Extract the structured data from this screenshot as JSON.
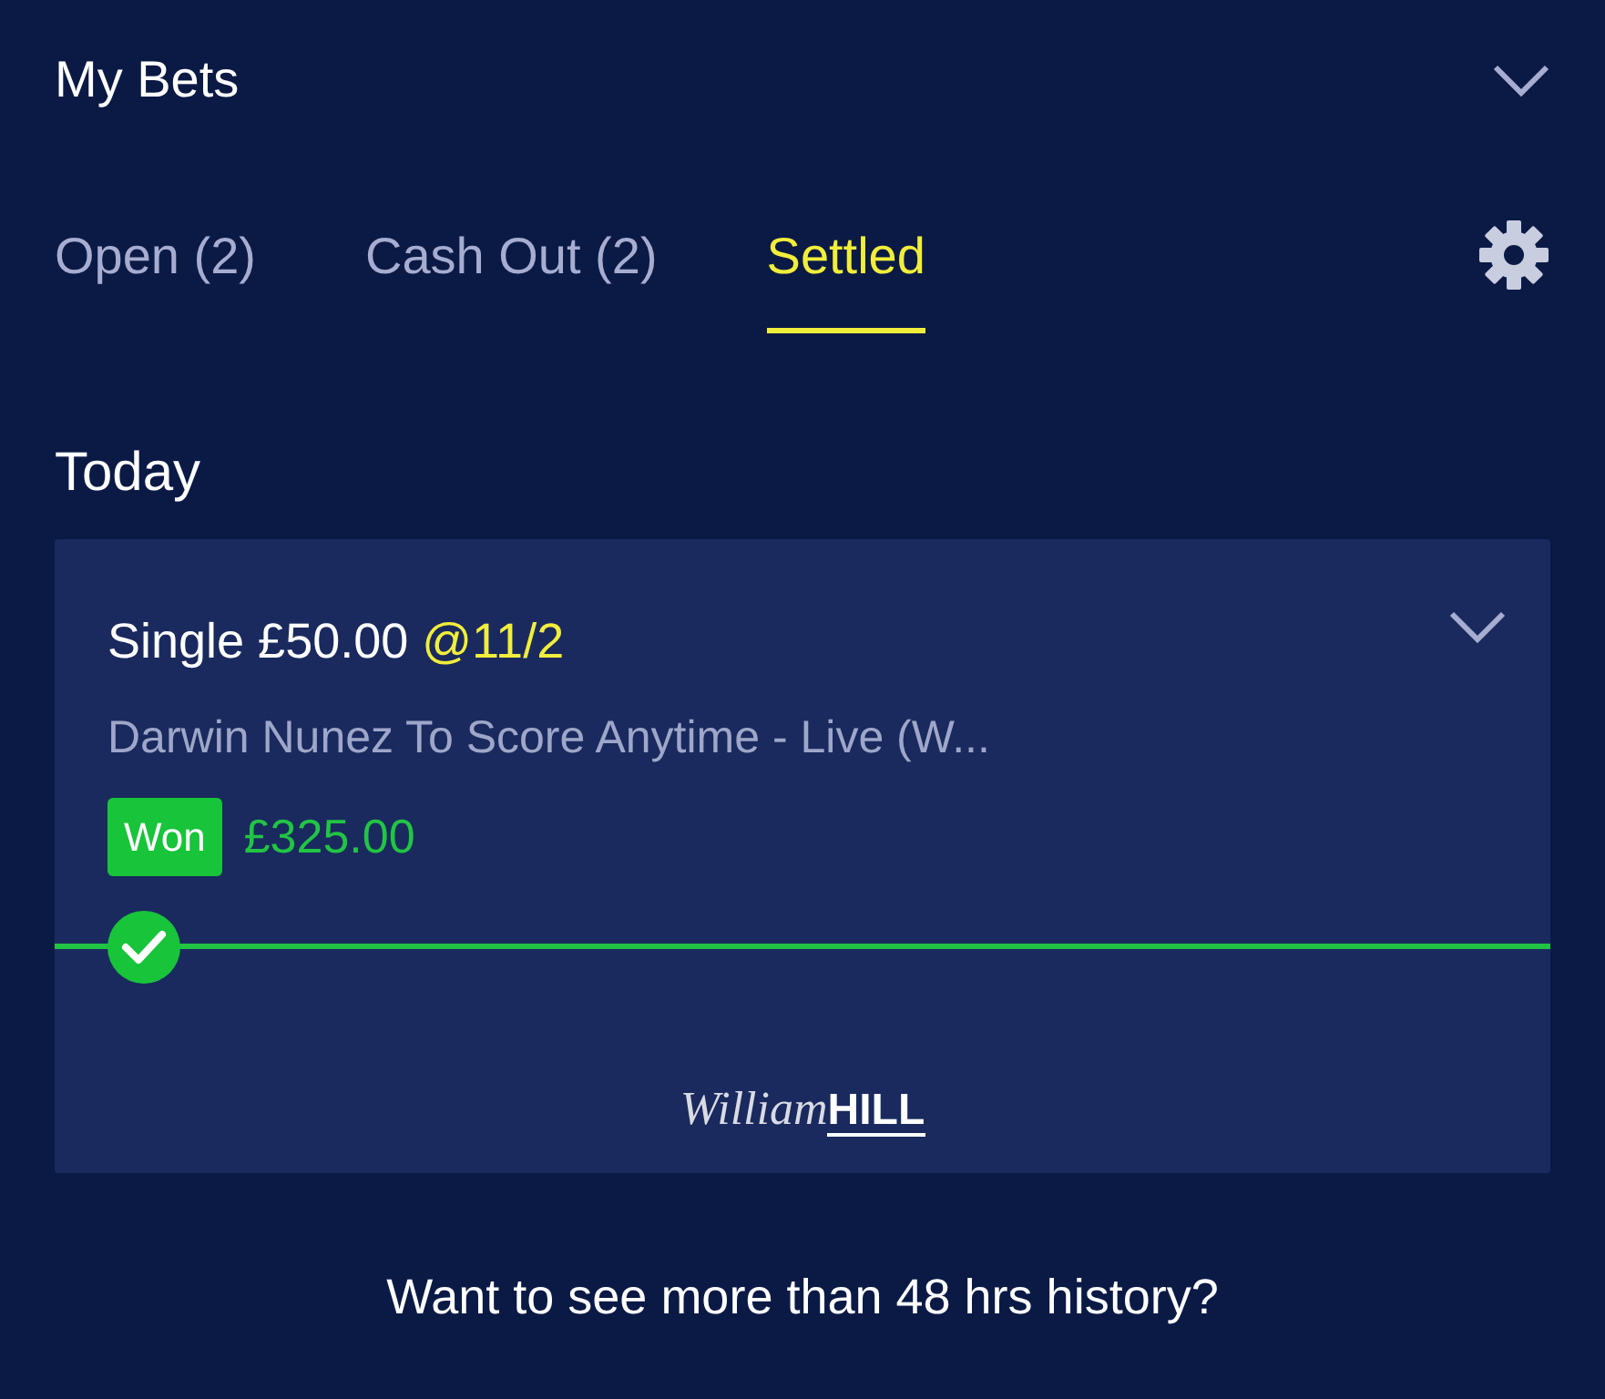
{
  "header": {
    "title": "My Bets",
    "expanded": false
  },
  "tabs": [
    {
      "label": "Open (2)",
      "selected": false
    },
    {
      "label": "Cash Out (2)",
      "selected": false
    },
    {
      "label": "Settled",
      "selected": true
    }
  ],
  "section_title": "Today",
  "bets": [
    {
      "type": "Single",
      "stake": "£50.00",
      "odds": "@11/2",
      "selection": "Darwin Nunez To Score Anytime - Live (W...",
      "result": "Won",
      "returns": "£325.00",
      "expanded": false,
      "settled": true,
      "logo": {
        "script": "William",
        "block": "HILL"
      }
    }
  ],
  "footer": "Want to see more than 48 hrs history?"
}
